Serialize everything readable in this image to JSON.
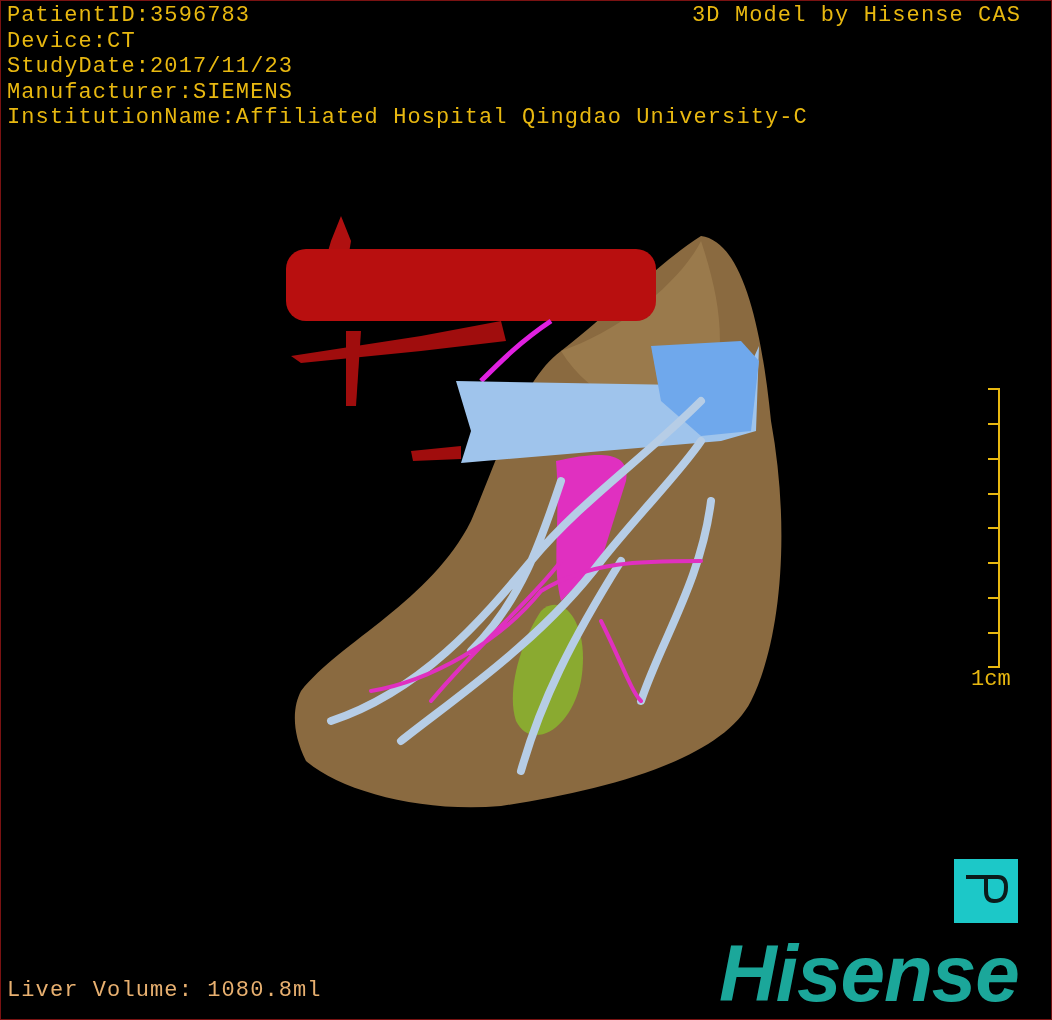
{
  "info_lines": [
    "PatientID:3596783",
    "Device:CT",
    "StudyDate:2017/11/23",
    "Manufacturer:SIEMENS",
    "InstitutionName:Affiliated Hospital Qingdao University-C"
  ],
  "model_credit": "3D Model by Hisense CAS",
  "scale_bar": {
    "label": "1cm"
  },
  "liver_volume": "Liver Volume: 1080.8ml",
  "logo": {
    "text": "Hisense"
  }
}
